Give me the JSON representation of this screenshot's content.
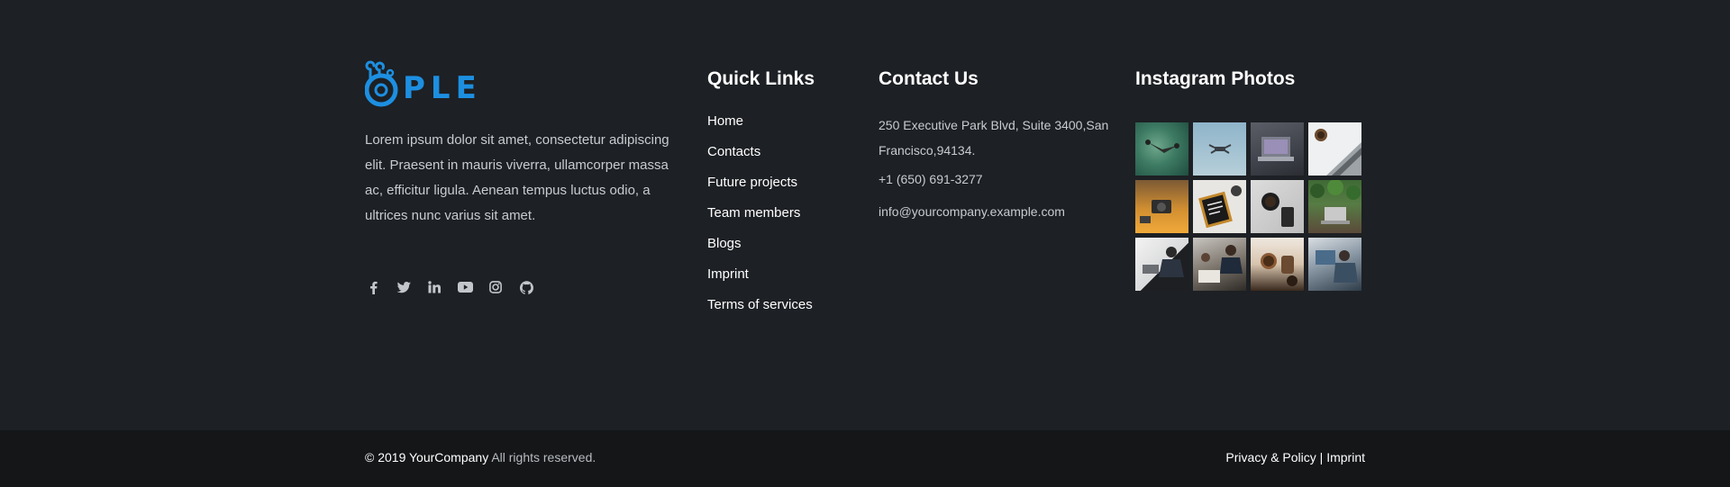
{
  "brand": {
    "logo_text": "PLE",
    "logo_color": "#1d8fe1"
  },
  "about": {
    "text": "Lorem ipsum dolor sit amet, consectetur adipiscing elit. Praesent in mauris viverra, ullamcorper massa ac, efficitur ligula. Aenean tempus luctus odio, a ultrices nunc varius sit amet."
  },
  "socials": [
    {
      "icon": "facebook-icon"
    },
    {
      "icon": "twitter-icon"
    },
    {
      "icon": "linkedin-icon"
    },
    {
      "icon": "youtube-icon"
    },
    {
      "icon": "instagram-icon"
    },
    {
      "icon": "github-icon"
    }
  ],
  "quick_links": {
    "title": "Quick Links",
    "items": [
      {
        "label": "Home"
      },
      {
        "label": "Contacts"
      },
      {
        "label": "Future projects"
      },
      {
        "label": "Team members"
      },
      {
        "label": "Blogs"
      },
      {
        "label": "Imprint"
      },
      {
        "label": "Terms of services"
      }
    ]
  },
  "contact": {
    "title": "Contact Us",
    "address": "250 Executive Park Blvd, Suite 3400,San Francisco,94134.",
    "phone": "+1 (650) 691-3277",
    "email": "info@yourcompany.example.com"
  },
  "instagram": {
    "title": "Instagram Photos",
    "photos": [
      {
        "subject": "drone over green background"
      },
      {
        "subject": "drone against blue sky"
      },
      {
        "subject": "laptop on desk"
      },
      {
        "subject": "keyboard and coffee"
      },
      {
        "subject": "camera on orange desk"
      },
      {
        "subject": "letter board on desk"
      },
      {
        "subject": "coffee cup and phone"
      },
      {
        "subject": "laptop with plants"
      },
      {
        "subject": "person working at laptop"
      },
      {
        "subject": "team working at table"
      },
      {
        "subject": "coffee making"
      },
      {
        "subject": "person at office desk"
      }
    ]
  },
  "footer": {
    "copyright_prefix": "© 2019 YourCompany",
    "copyright_suffix": " All rights reserved.",
    "privacy_label": "Privacy & Policy",
    "separator": " | ",
    "imprint_label": "Imprint"
  }
}
